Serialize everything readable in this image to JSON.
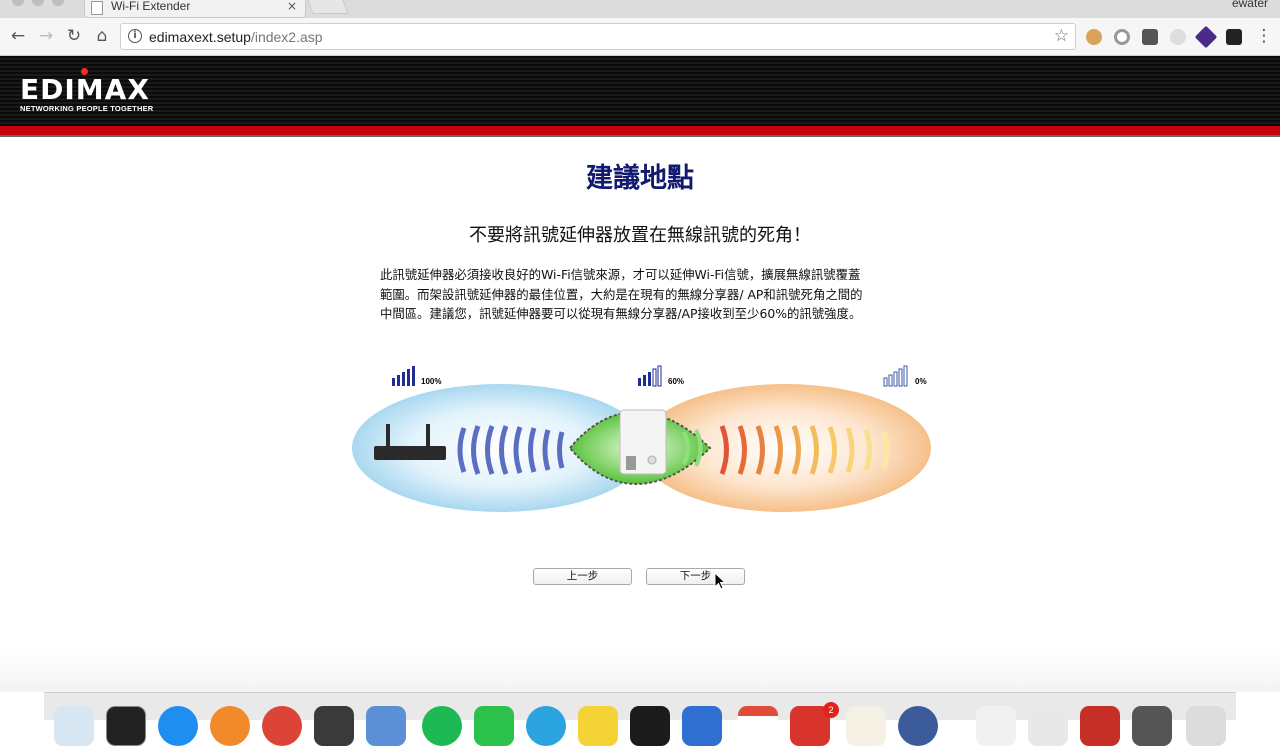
{
  "browser": {
    "tab_title": "Wi-Fi Extender",
    "tab_close": "×",
    "user_name": "ewater",
    "url_host": "edimaxext.setup",
    "url_path": "/index2.asp",
    "back_icon": "←",
    "forward_icon": "→",
    "reload_icon": "↻",
    "home_icon": "⌂",
    "star_icon": "☆",
    "info_icon": "i",
    "menu_icon": "⋮"
  },
  "header": {
    "logo_text": "EDIMAX",
    "tagline": "NETWORKING PEOPLE TOGETHER"
  },
  "main": {
    "title": "建議地點",
    "subtitle": "不要將訊號延伸器放置在無線訊號的死角！",
    "description_line1": "此訊號延伸器必須接收良好的Wi-Fi信號來源，才可以延伸Wi-Fi信號，擴展無線訊號覆蓋",
    "description_line2": "範圍。而架設訊號延伸器的最佳位置，大約是在現有的無線分享器/ AP和訊號死角之間的",
    "description_line3": "中間區。建議您，訊號延伸器要可以從現有無線分享器/AP接收到至少60%的訊號強度。"
  },
  "diagram": {
    "signal_left": "100%",
    "signal_middle": "60%",
    "signal_right": "0%",
    "colors": {
      "router_zone": "#bfe3f5",
      "deadzone": "#f8cfa3",
      "extender_zone": "#7fd65b",
      "wave_blue": "#5b6fc2",
      "wave_red": "#e0553a"
    }
  },
  "buttons": {
    "prev": "上一步",
    "next": "下一步"
  },
  "dock": {
    "badge_count": "2"
  }
}
